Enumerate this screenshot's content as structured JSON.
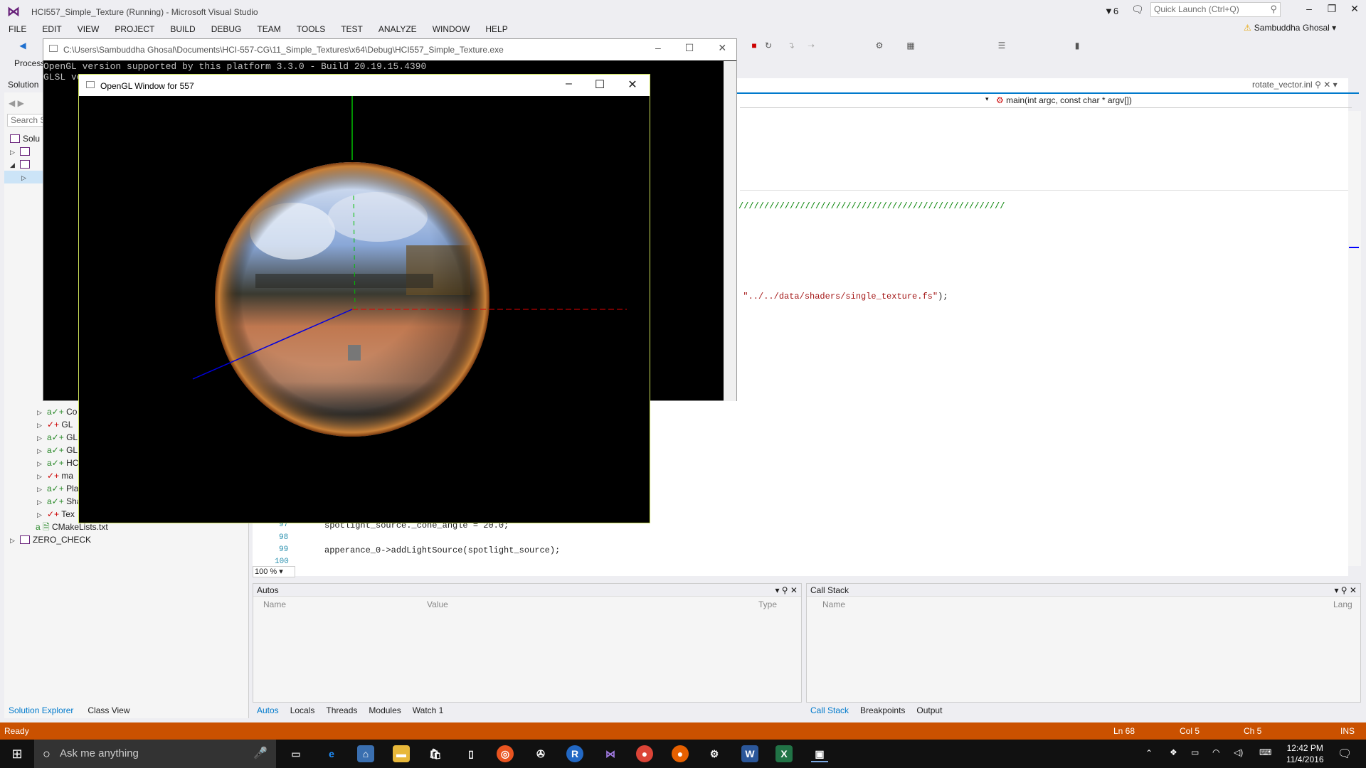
{
  "app": {
    "title": "HCI557_Simple_Texture (Running) - Microsoft Visual Studio",
    "filter_count": "6",
    "quick_launch_placeholder": "Quick Launch (Ctrl+Q)",
    "user": "Sambuddha Ghosal"
  },
  "menu": [
    "FILE",
    "EDIT",
    "VIEW",
    "PROJECT",
    "BUILD",
    "DEBUG",
    "TEAM",
    "TOOLS",
    "TEST",
    "ANALYZE",
    "WINDOW",
    "HELP"
  ],
  "toolbar": {
    "process_label": "Process"
  },
  "solution_explorer": {
    "header": "Solution",
    "search_placeholder": "Search So",
    "root_label": "Solu",
    "items": [
      "Co",
      "GL",
      "GL",
      "GL",
      "HC",
      "ma",
      "Pla",
      "Sha",
      "Tex"
    ],
    "cmake": "CMakeLists.txt",
    "zero_check": "ZERO_CHECK",
    "tabs": [
      "Solution Explorer",
      "Class View"
    ]
  },
  "editor": {
    "doc_tab": "rotate_vector.inl",
    "nav_function": "main(int argc, const char * argv[])",
    "comment": "////////////////////////////////////////////////////",
    "shader_prefix": ", ",
    "shader_string": "\"../../data/shaders/single_texture.fs\"",
    "shader_suffix": ");",
    "lines": [
      {
        "num": "97",
        "code": "spotlight_source._cone_angle = 20.0;"
      },
      {
        "num": "98",
        "code": ""
      },
      {
        "num": "99",
        "code": "apperance_0->addLightSource(spotlight_source);"
      },
      {
        "num": "100",
        "code": ""
      }
    ],
    "zoom": "100 %"
  },
  "autos": {
    "title": "Autos",
    "columns": [
      "Name",
      "Value",
      "Type"
    ],
    "tabs": [
      "Autos",
      "Locals",
      "Threads",
      "Modules",
      "Watch 1"
    ]
  },
  "callstack": {
    "title": "Call Stack",
    "columns": [
      "Name",
      "Lang"
    ],
    "tabs": [
      "Call Stack",
      "Breakpoints",
      "Output"
    ]
  },
  "status": {
    "state": "Ready",
    "line": "Ln 68",
    "col": "Col 5",
    "ch": "Ch 5",
    "mode": "INS"
  },
  "console": {
    "title": "C:\\Users\\Sambuddha Ghosal\\Documents\\HCI-557-CG\\11_Simple_Textures\\x64\\Debug\\HCI557_Simple_Texture.exe",
    "line1": "OpenGL version supported by this platform 3.3.0 - Build 20.19.15.4390",
    "line2": "GLSL ve"
  },
  "glwindow": {
    "title": "OpenGL Window for 557"
  },
  "taskbar": {
    "search_placeholder": "Ask me anything",
    "time": "12:42 PM",
    "date": "11/4/2016"
  },
  "colors": {
    "status_bar": "#ca5100",
    "accent": "#007acc",
    "axis_x": "#e00000",
    "axis_y": "#00c000",
    "axis_z": "#0000e0"
  }
}
